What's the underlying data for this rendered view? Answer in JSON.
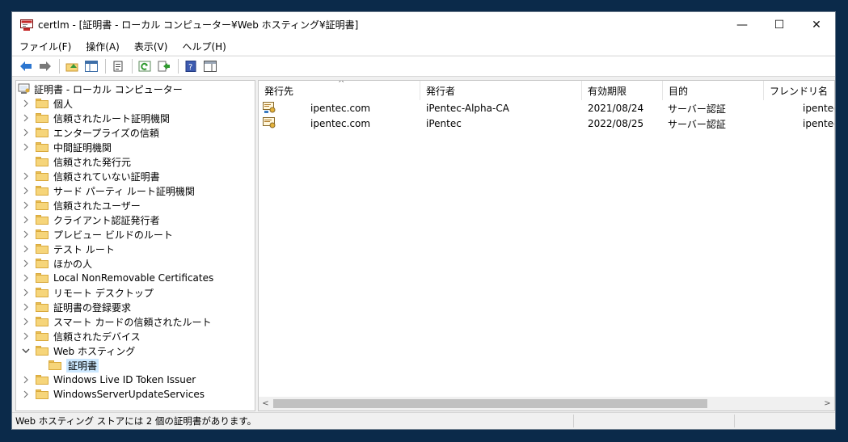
{
  "window": {
    "title": "certlm - [証明書 - ローカル コンピューター¥Web ホスティング¥証明書]",
    "controls": {
      "minimize": "—",
      "maximize": "☐",
      "close": "✕"
    }
  },
  "menu": [
    "ファイル(F)",
    "操作(A)",
    "表示(V)",
    "ヘルプ(H)"
  ],
  "toolbar": {
    "icons": [
      "back-icon",
      "forward-icon",
      "up-folder-icon",
      "show-hide-tree-icon",
      "properties-icon",
      "refresh-icon",
      "export-list-icon",
      "help-icon",
      "action-pane-icon"
    ]
  },
  "tree": {
    "root": "証明書 - ローカル コンピューター",
    "items": [
      {
        "label": "個人",
        "expandable": true
      },
      {
        "label": "信頼されたルート証明機関",
        "expandable": true
      },
      {
        "label": "エンタープライズの信頼",
        "expandable": true
      },
      {
        "label": "中間証明機関",
        "expandable": true
      },
      {
        "label": "信頼された発行元",
        "expandable": false
      },
      {
        "label": "信頼されていない証明書",
        "expandable": true
      },
      {
        "label": "サード パーティ ルート証明機関",
        "expandable": true
      },
      {
        "label": "信頼されたユーザー",
        "expandable": true
      },
      {
        "label": "クライアント認証発行者",
        "expandable": true
      },
      {
        "label": "プレビュー ビルドのルート",
        "expandable": true
      },
      {
        "label": "テスト ルート",
        "expandable": true
      },
      {
        "label": "ほかの人",
        "expandable": true
      },
      {
        "label": "Local NonRemovable Certificates",
        "expandable": true
      },
      {
        "label": "リモート デスクトップ",
        "expandable": true
      },
      {
        "label": "証明書の登録要求",
        "expandable": true
      },
      {
        "label": "スマート カードの信頼されたルート",
        "expandable": true
      },
      {
        "label": "信頼されたデバイス",
        "expandable": true
      },
      {
        "label": "Web ホスティング",
        "expandable": true,
        "expanded": true
      },
      {
        "label": "証明書",
        "child": true,
        "selected": true
      },
      {
        "label": "Windows Live ID Token Issuer",
        "expandable": true
      },
      {
        "label": "WindowsServerUpdateServices",
        "expandable": true
      }
    ]
  },
  "list": {
    "sort_indicator": "^",
    "columns": [
      "発行先",
      "発行者",
      "有効期限",
      "目的",
      "フレンドリ名"
    ],
    "rows": [
      [
        "ipentec.com",
        "iPentec-Alpha-CA",
        "2021/08/24",
        "サーバー認証",
        "ipentec"
      ],
      [
        "ipentec.com",
        "iPentec",
        "2022/08/25",
        "サーバー認証",
        "ipentec"
      ]
    ]
  },
  "scrollbar": {
    "left_arrow": "<",
    "right_arrow": ">"
  },
  "status": {
    "text": "Web ホスティング ストアには 2 個の証明書があります。"
  }
}
